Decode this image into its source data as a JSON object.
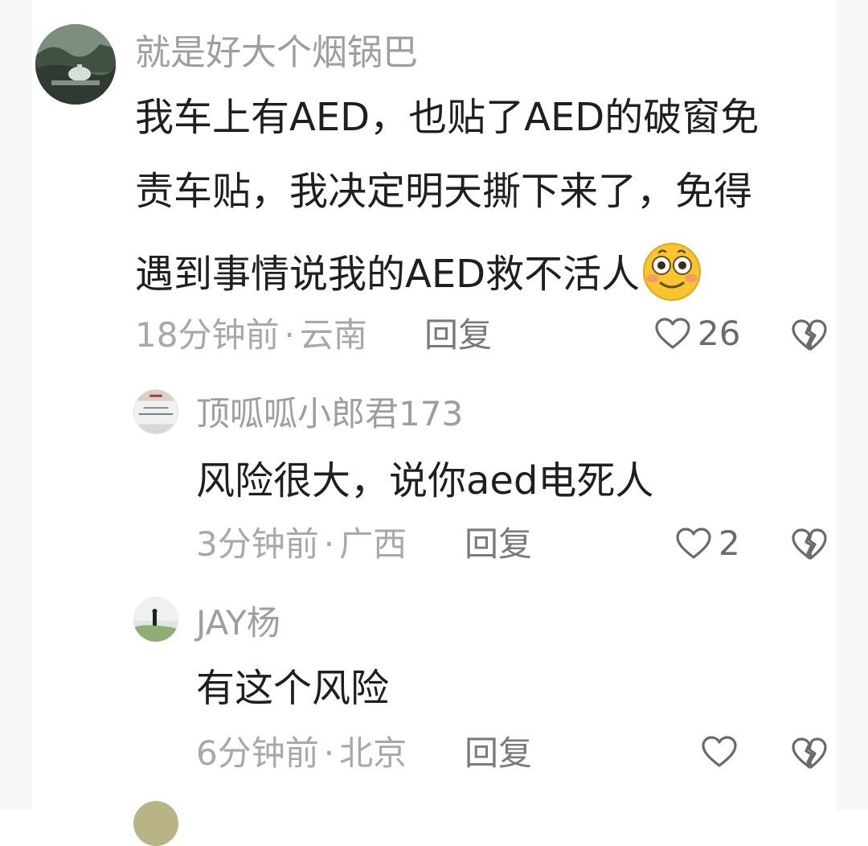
{
  "colors": {
    "username": "#9e9e9e",
    "content": "#1f1f1f",
    "meta": "#a8a8a8",
    "action": "#7a7a7a",
    "background": "#ffffff"
  },
  "comments": [
    {
      "username": "就是好大个烟锅巴",
      "content_lines": [
        "我车上有AED，也贴了AED的破窗免",
        "责车贴，我决定明天撕下来了，免得",
        "遇到事情说我的AED救不活人"
      ],
      "emoji": "flushed-smile-emoji",
      "time": "18分钟前",
      "dot": "·",
      "location": "云南",
      "reply_label": "回复",
      "likes": "26"
    },
    {
      "username": "顶呱呱小郎君173",
      "content_lines": [
        "风险很大，说你aed电死人"
      ],
      "time": "3分钟前",
      "dot": "·",
      "location": "广西",
      "reply_label": "回复",
      "likes": "2"
    },
    {
      "username": "JAY杨",
      "content_lines": [
        "有这个风险"
      ],
      "time": "6分钟前",
      "dot": "·",
      "location": "北京",
      "reply_label": "回复",
      "likes": ""
    }
  ]
}
